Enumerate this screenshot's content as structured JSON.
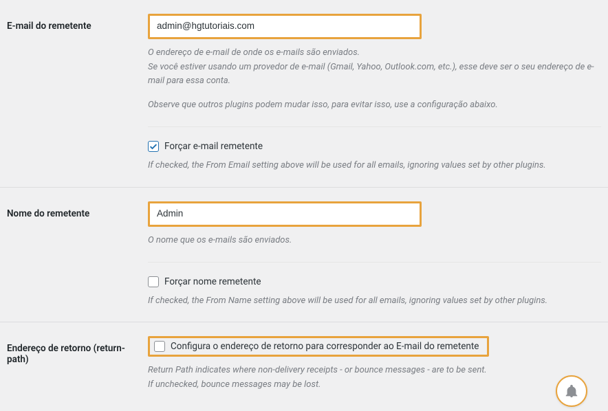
{
  "email_section": {
    "label": "E-mail do remetente",
    "value": "admin@hgtutoriais.com",
    "desc1_line1": "O endereço de e-mail de onde os e-mails são enviados.",
    "desc1_line2": "Se você estiver usando um provedor de e-mail (Gmail, Yahoo, Outlook.com, etc.), esse deve ser o seu endereço de e-mail para essa conta.",
    "desc2": "Observe que outros plugins podem mudar isso, para evitar isso, use a configuração abaixo.",
    "force_label": "Forçar e-mail remetente",
    "force_help": "If checked, the From Email setting above will be used for all emails, ignoring values set by other plugins."
  },
  "name_section": {
    "label": "Nome do remetente",
    "value": "Admin",
    "desc": "O nome que os e-mails são enviados.",
    "force_label": "Forçar nome remetente",
    "force_help": "If checked, the From Name setting above will be used for all emails, ignoring values set by other plugins."
  },
  "return_section": {
    "label": "Endereço de retorno (return-path)",
    "checkbox_label": "Configura o endereço de retorno para corresponder ao E-mail do remetente",
    "help_line1": "Return Path indicates where non-delivery receipts - or bounce messages - are to be sent.",
    "help_line2": "If unchecked, bounce messages may be lost."
  }
}
